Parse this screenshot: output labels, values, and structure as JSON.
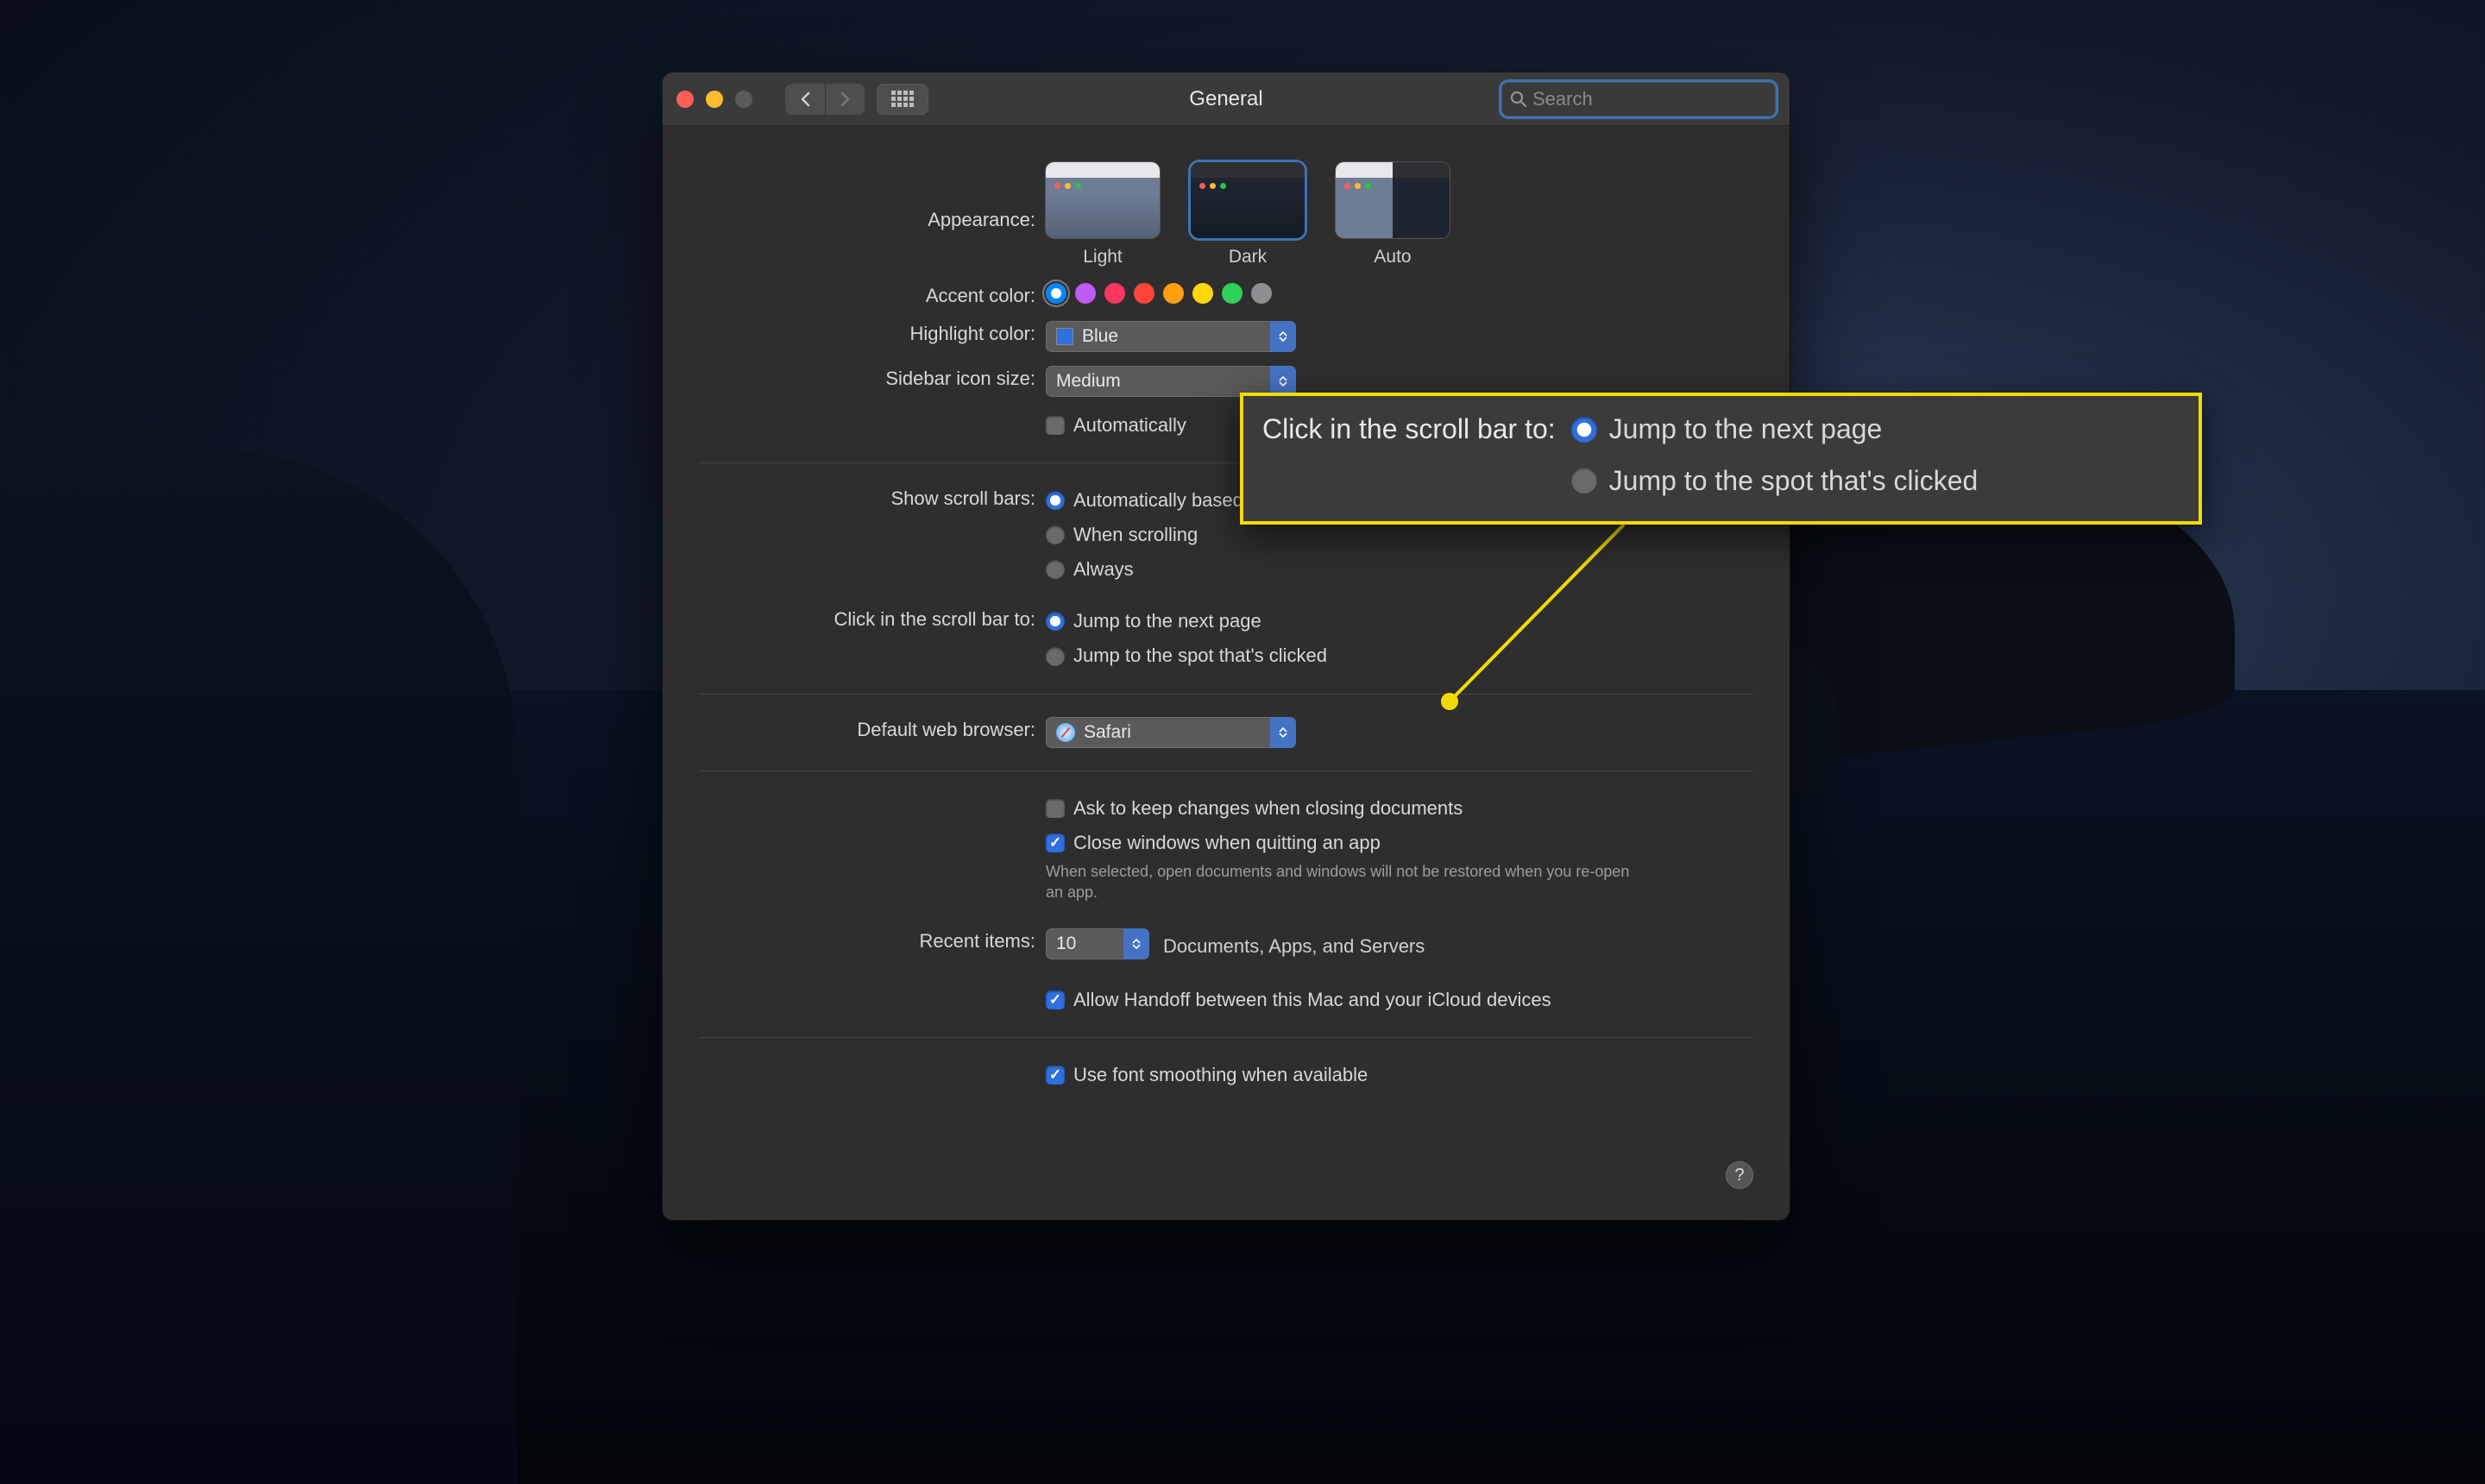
{
  "window": {
    "title": "General"
  },
  "search": {
    "placeholder": "Search"
  },
  "labels": {
    "appearance": "Appearance:",
    "accent": "Accent color:",
    "highlight": "Highlight color:",
    "sidebar": "Sidebar icon size:",
    "scrollbars": "Show scroll bars:",
    "clickscroll": "Click in the scroll bar to:",
    "browser": "Default web browser:",
    "recent": "Recent items:"
  },
  "appearance": {
    "options": [
      {
        "label": "Light"
      },
      {
        "label": "Dark"
      },
      {
        "label": "Auto"
      }
    ],
    "selected": "Dark"
  },
  "accent_colors": [
    "#0a84ff",
    "#bf5af2",
    "#ff375f",
    "#ff453a",
    "#ff9f0a",
    "#ffd60a",
    "#30d158",
    "#8e8e93"
  ],
  "highlight": {
    "value": "Blue"
  },
  "sidebar_size": {
    "value": "Medium"
  },
  "sidebar_autohide": {
    "label": "Automatically"
  },
  "scrollbars": {
    "auto": "Automatically based on mouse or trackpad",
    "scrolling": "When scrolling",
    "always": "Always"
  },
  "clickscroll": {
    "next": "Jump to the next page",
    "spot": "Jump to the spot that's clicked"
  },
  "browser": {
    "value": "Safari"
  },
  "docs": {
    "ask": "Ask to keep changes when closing documents",
    "close": "Close windows when quitting an app",
    "note": "When selected, open documents and windows will not be restored when you re-open an app."
  },
  "recent": {
    "value": "10",
    "suffix": "Documents, Apps, and Servers"
  },
  "handoff": {
    "label": "Allow Handoff between this Mac and your iCloud devices"
  },
  "fontsmoothing": {
    "label": "Use font smoothing when available"
  },
  "callout": {
    "label": "Click in the scroll bar to:",
    "opt1": "Jump to the next page",
    "opt2": "Jump to the spot that's clicked"
  }
}
